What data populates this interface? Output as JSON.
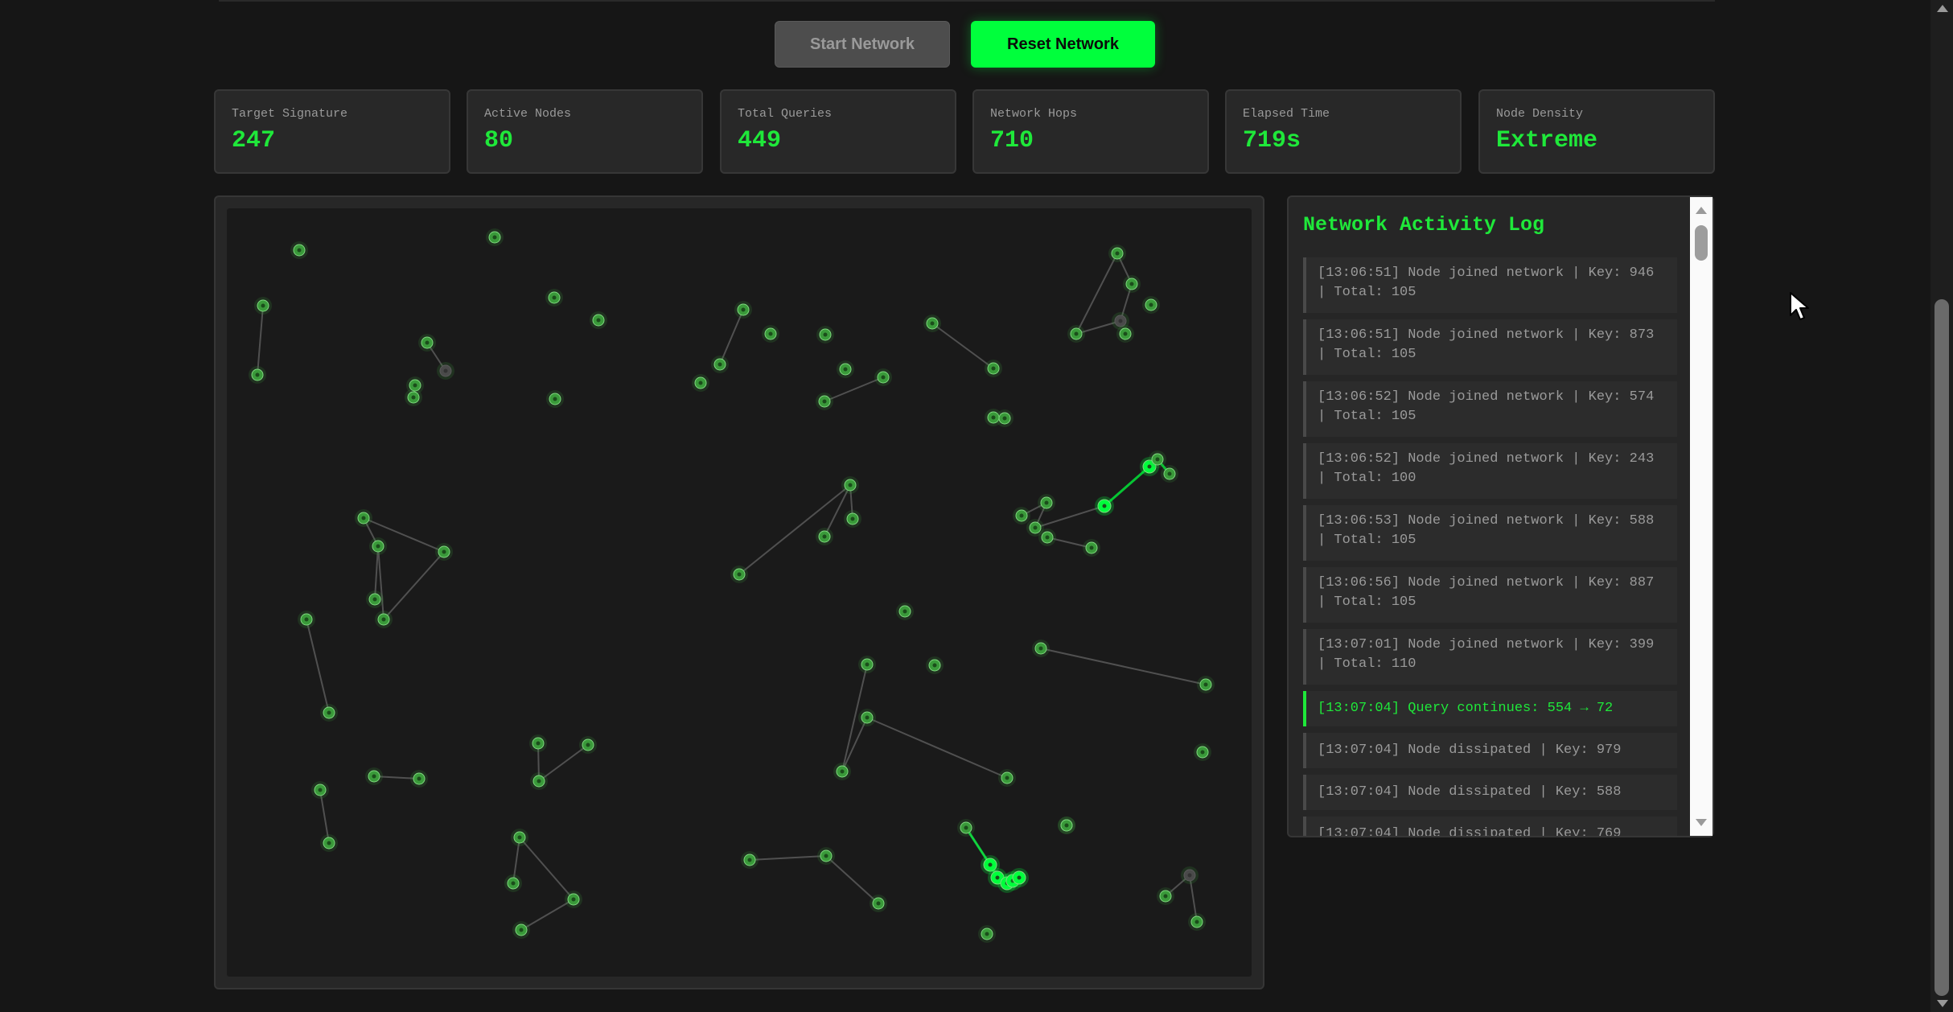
{
  "controls": {
    "start_label": "Start Network",
    "reset_label": "Reset Network"
  },
  "stats": [
    {
      "label": "Target Signature",
      "value": "247"
    },
    {
      "label": "Active Nodes",
      "value": "80"
    },
    {
      "label": "Total Queries",
      "value": "449"
    },
    {
      "label": "Network Hops",
      "value": "710"
    },
    {
      "label": "Elapsed Time",
      "value": "719s"
    },
    {
      "label": "Node Density",
      "value": "Extreme"
    }
  ],
  "log": {
    "title": "Network Activity Log",
    "entries": [
      {
        "text": "[13:06:51] Node joined network | Key: 946 | Total: 105",
        "type": "join"
      },
      {
        "text": "[13:06:51] Node joined network | Key: 873 | Total: 105",
        "type": "join"
      },
      {
        "text": "[13:06:52] Node joined network | Key: 574 | Total: 105",
        "type": "join"
      },
      {
        "text": "[13:06:52] Node joined network | Key: 243 | Total: 100",
        "type": "join"
      },
      {
        "text": "[13:06:53] Node joined network | Key: 588 | Total: 105",
        "type": "join"
      },
      {
        "text": "[13:06:56] Node joined network | Key: 887 | Total: 105",
        "type": "join"
      },
      {
        "text": "[13:07:01] Node joined network | Key: 399 | Total: 110",
        "type": "join"
      },
      {
        "text": "[13:07:04] Query continues: 554 → 72",
        "type": "query"
      },
      {
        "text": "[13:07:04] Node dissipated | Key: 979",
        "type": "dissipate"
      },
      {
        "text": "[13:07:04] Node dissipated | Key: 588",
        "type": "dissipate"
      },
      {
        "text": "[13:07:04] Node dissipated | Key: 769",
        "type": "dissipate"
      }
    ]
  },
  "colors": {
    "accent": "#1fe83a",
    "node": "#3a9a3a",
    "node_active": "#00ff3c",
    "edge": "#555555"
  },
  "icons": {
    "cursor": "mouse-pointer-icon",
    "scroll_up": "scroll-up-arrow-icon",
    "scroll_down": "scroll-down-arrow-icon"
  }
}
